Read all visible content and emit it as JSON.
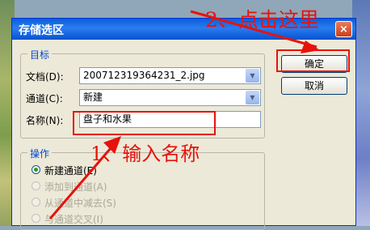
{
  "dialog": {
    "title": "存储选区",
    "close_label": "×"
  },
  "target_group": {
    "title": "目标",
    "document_label": "文档(D):",
    "document_value": "200712319364231_2.jpg",
    "channel_label": "通道(C):",
    "channel_value": "新建",
    "name_label": "名称(N):",
    "name_value": "盘子和水果"
  },
  "buttons": {
    "ok": "确定",
    "cancel": "取消"
  },
  "operation_group": {
    "title": "操作",
    "options": [
      {
        "label": "新建通道(E)",
        "selected": true,
        "enabled": true
      },
      {
        "label": "添加到通道(A)",
        "selected": false,
        "enabled": false
      },
      {
        "label": "从通道中减去(S)",
        "selected": false,
        "enabled": false
      },
      {
        "label": "与通道交叉(I)",
        "selected": false,
        "enabled": false
      }
    ]
  },
  "annotations": {
    "step1": "1、输入名称",
    "step2": "2、点击这里"
  },
  "colors": {
    "annotation_red": "#e8120c",
    "title_bar_blue": "#0a5fd8",
    "dialog_bg": "#ece9d8"
  }
}
